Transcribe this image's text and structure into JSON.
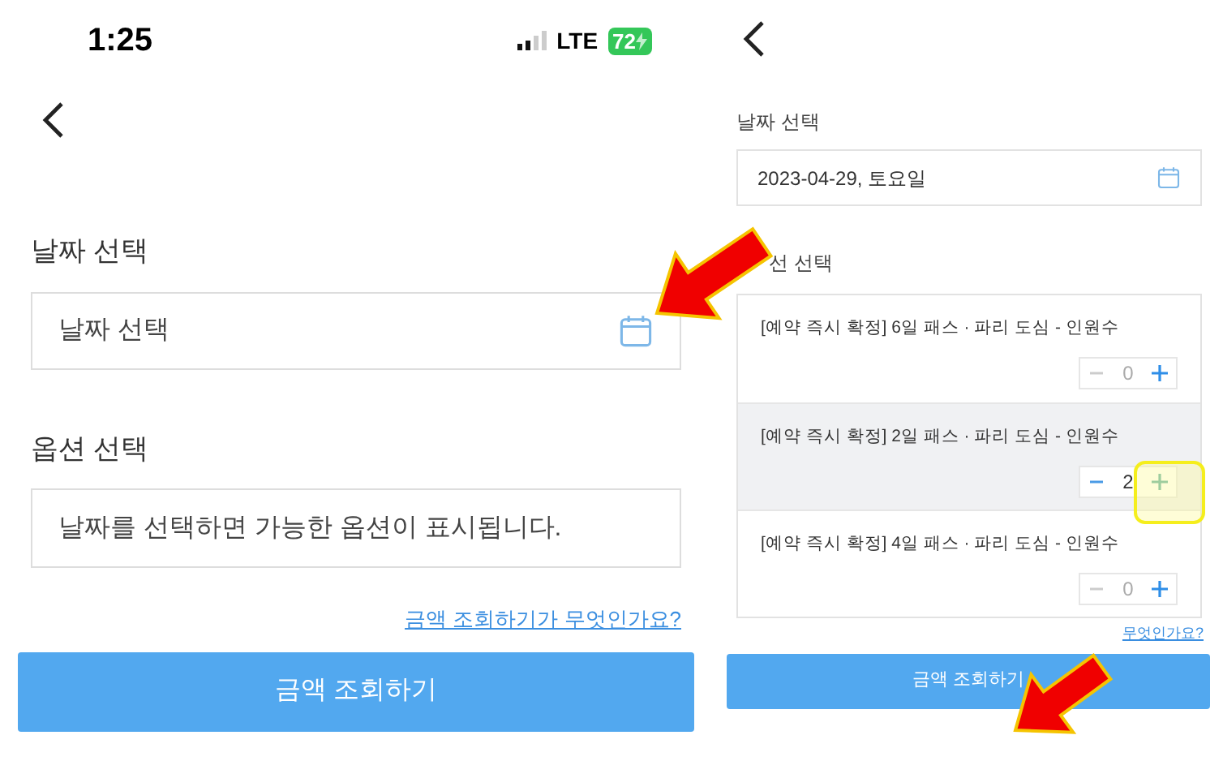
{
  "left_screen": {
    "status_bar": {
      "time": "1:25",
      "network": "LTE",
      "battery": "72"
    },
    "date_section": {
      "label": "날짜 선택",
      "placeholder": "날짜 선택"
    },
    "option_section": {
      "label": "옵션 선택",
      "message": "날짜를 선택하면 가능한 옵션이 표시됩니다."
    },
    "help_link": "금액 조회하기가 무엇인가요?",
    "submit_button": "금액 조회하기"
  },
  "right_screen": {
    "date_section": {
      "label": "날짜 선택",
      "value": "2023-04-29, 토요일"
    },
    "option_section": {
      "label": "선 선택",
      "options": [
        {
          "title": "[예약 즉시 확정] 6일 패스 · 파리 도심 - 인원수",
          "count": "0",
          "minus_enabled": false,
          "selected": false,
          "highlighted": false
        },
        {
          "title": "[예약 즉시 확정] 2일 패스 · 파리 도심 - 인원수",
          "count": "2",
          "minus_enabled": true,
          "selected": true,
          "highlighted": true
        },
        {
          "title": "[예약 즉시 확정] 4일 패스 · 파리 도심 - 인원수",
          "count": "0",
          "minus_enabled": false,
          "selected": false,
          "highlighted": false
        }
      ]
    },
    "help_link": "무엇인가요?",
    "submit_button": "금액 조회하기"
  }
}
